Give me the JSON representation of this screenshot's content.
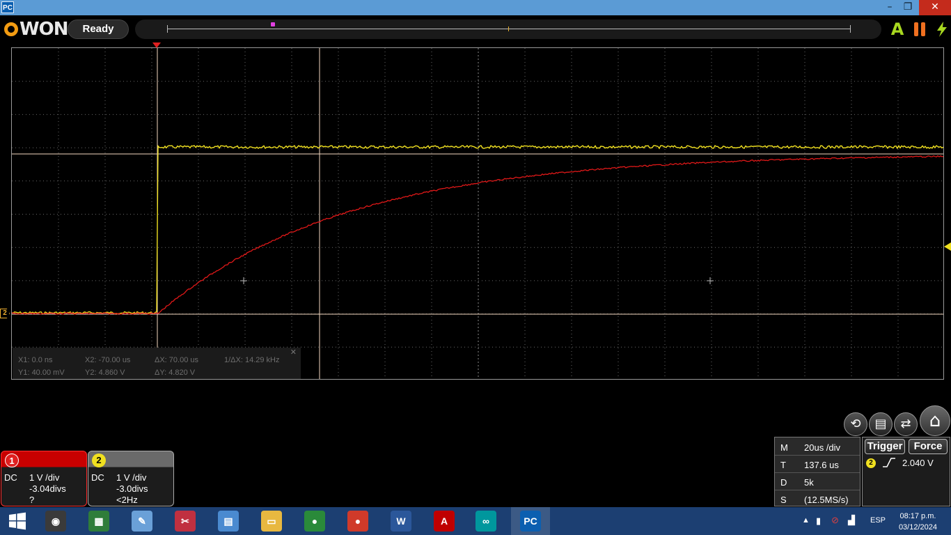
{
  "titlebar": {
    "app_icon_label": "PC",
    "minimize": "–",
    "restore": "❐",
    "close": "✕"
  },
  "toolbar": {
    "brand": "WON",
    "status": "Ready",
    "auto_icon": "A",
    "run_stop_icon": "pause-icon",
    "single_icon": "lightning-icon"
  },
  "cursor": {
    "x1": "X1: 0.0 ns",
    "x2": "X2: -70.00 us",
    "dx": "ΔX: 70.00 us",
    "inv_dx": "1/ΔX: 14.29 kHz",
    "y1": "Y1: 40.00 mV",
    "y2": "Y2: 4.860 V",
    "dy": "ΔY: 4.820 V",
    "close": "✕"
  },
  "channels": [
    {
      "id": "1",
      "coupling": "DC",
      "scale": "1 V /div",
      "offset": "-3.04divs",
      "freq": "?",
      "color": "#e02020"
    },
    {
      "id": "2",
      "coupling": "DC",
      "scale": "1 V /div",
      "offset": "-3.0divs",
      "freq": "<2Hz",
      "color": "#f0e020"
    }
  ],
  "markers": {
    "ch2": "2"
  },
  "info": [
    {
      "k": "M",
      "v": "20us /div"
    },
    {
      "k": "T",
      "v": "137.6 us"
    },
    {
      "k": "D",
      "v": "5k"
    },
    {
      "k": "S",
      "v": "(12.5MS/s)"
    }
  ],
  "trigger": {
    "trigger_label": "Trigger",
    "force_label": "Force",
    "source": "2",
    "level": "2.040 V"
  },
  "taskbar": {
    "apps": [
      {
        "name": "camera",
        "label": "◉",
        "color": "#3a3a3a"
      },
      {
        "name": "calculator",
        "label": "▦",
        "color": "#2f7d3a"
      },
      {
        "name": "notes",
        "label": "✎",
        "color": "#6aa0d8"
      },
      {
        "name": "snipping",
        "label": "✂",
        "color": "#c03040"
      },
      {
        "name": "control-panel",
        "label": "▤",
        "color": "#4a8ad0"
      },
      {
        "name": "file-explorer",
        "label": "▭",
        "color": "#e8b840"
      },
      {
        "name": "chrome",
        "label": "●",
        "color": "#2a8a3a"
      },
      {
        "name": "chrome-profile",
        "label": "●",
        "color": "#d03a2a"
      },
      {
        "name": "word",
        "label": "W",
        "color": "#2b579a"
      },
      {
        "name": "acrobat",
        "label": "A",
        "color": "#c00000"
      },
      {
        "name": "arduino",
        "label": "∞",
        "color": "#00979d"
      },
      {
        "name": "owon-pc",
        "label": "PC",
        "color": "#0b5fb0"
      }
    ],
    "language": "ESP",
    "time": "08:17 p.m.",
    "date": "03/12/2024"
  }
}
